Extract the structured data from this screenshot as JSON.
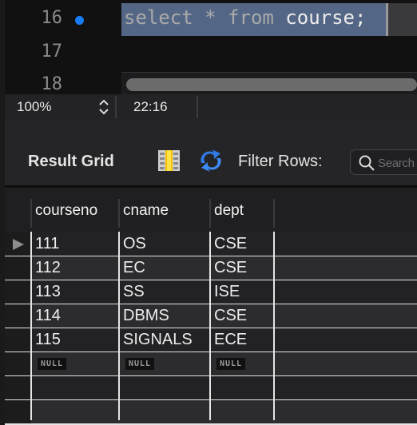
{
  "editor": {
    "lines": [
      "16",
      "17",
      "18"
    ],
    "code_keywords": [
      "select",
      "*",
      "from"
    ],
    "code_rest": " course;"
  },
  "status": {
    "zoom": "100%",
    "position": "22:16"
  },
  "toolbar": {
    "title": "Result Grid",
    "filter_label": "Filter Rows:",
    "search_placeholder": "Search",
    "icons": [
      "column-toggle-icon",
      "refresh-icon",
      "search-icon"
    ]
  },
  "grid": {
    "columns": [
      "courseno",
      "cname",
      "dept"
    ],
    "rows": [
      [
        "111",
        "OS",
        "CSE"
      ],
      [
        "112",
        "EC",
        "CSE"
      ],
      [
        "113",
        "SS",
        "ISE"
      ],
      [
        "114",
        "DBMS",
        "CSE"
      ],
      [
        "115",
        "SIGNALS",
        "ECE"
      ],
      [
        "NULL",
        "NULL",
        "NULL"
      ]
    ]
  },
  "colors": {
    "selection": "#546685",
    "breakpoint": "#1a7cf5"
  }
}
